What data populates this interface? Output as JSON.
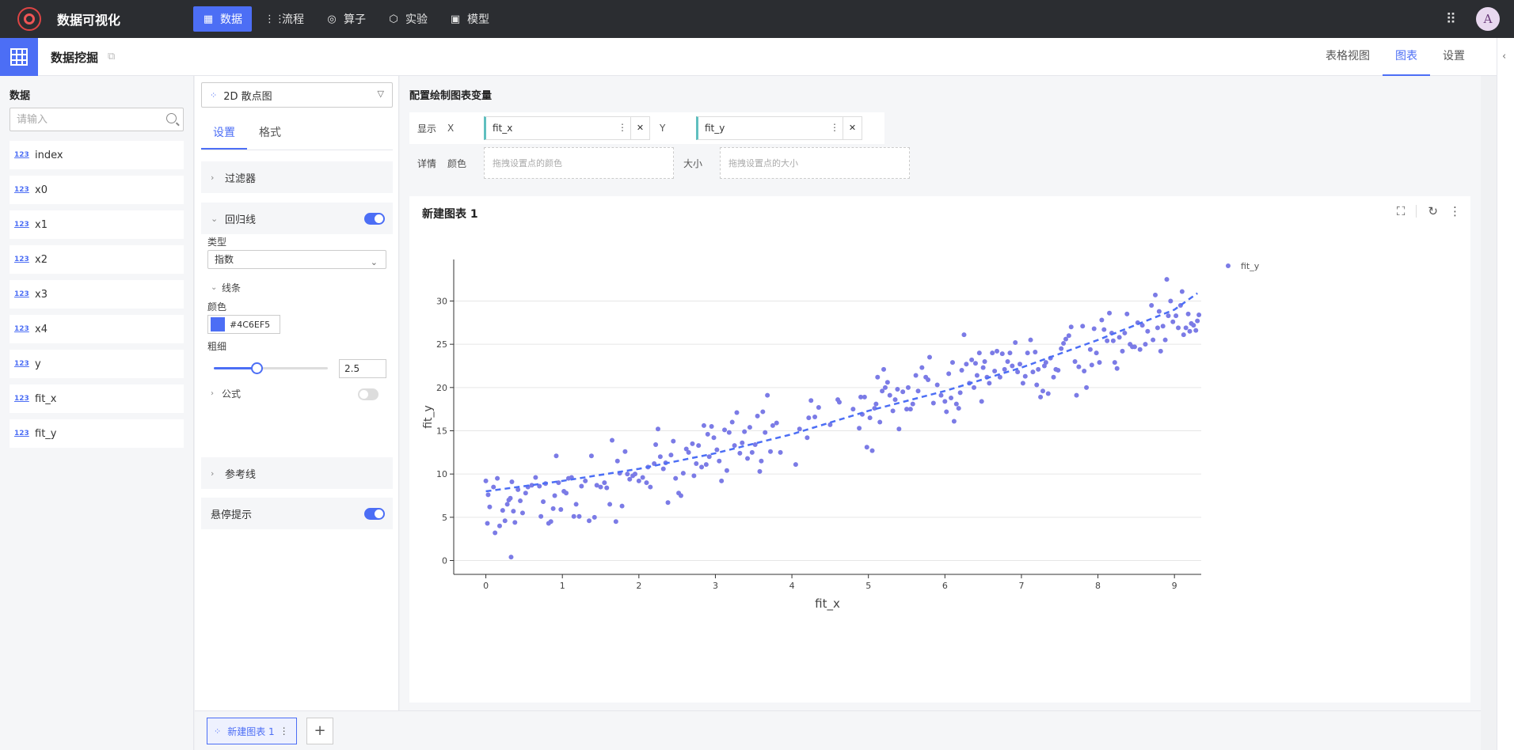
{
  "app": {
    "title": "数据可视化",
    "avatar": "A"
  },
  "nav": [
    {
      "label": "数据",
      "icon": "table-icon",
      "glyph": "▦",
      "active": true
    },
    {
      "label": "流程",
      "icon": "flow-icon",
      "glyph": "⋮⋮"
    },
    {
      "label": "算子",
      "icon": "operator-icon",
      "glyph": "◎"
    },
    {
      "label": "实验",
      "icon": "cube-icon",
      "glyph": "⬡"
    },
    {
      "label": "模型",
      "icon": "save-icon",
      "glyph": "▣"
    }
  ],
  "page": {
    "title": "数据挖掘"
  },
  "view_tabs": [
    {
      "label": "表格视图"
    },
    {
      "label": "图表",
      "active": true
    },
    {
      "label": "设置"
    }
  ],
  "data_panel": {
    "title": "数据",
    "search_placeholder": "请输入",
    "type_badge": "123",
    "fields": [
      "index",
      "x0",
      "x1",
      "x2",
      "x3",
      "x4",
      "y",
      "fit_x",
      "fit_y"
    ]
  },
  "config": {
    "chart_type": "2D 散点图",
    "tabs": [
      "设置",
      "格式"
    ],
    "filter_label": "过滤器",
    "regression_label": "回归线",
    "type_label": "类型",
    "type_value": "指数",
    "line_label": "线条",
    "color_label": "颜色",
    "color_value": "#4C6EF5",
    "width_label": "粗细",
    "width_value": "2.5",
    "width_fraction": 0.375,
    "formula_label": "公式",
    "refline_label": "参考线",
    "tooltip_label": "悬停提示"
  },
  "main": {
    "config_title": "配置绘制图表变量",
    "show_label": "显示",
    "detail_label": "详情",
    "x_label": "X",
    "y_label": "Y",
    "x_var": "fit_x",
    "y_var": "fit_y",
    "color_label": "颜色",
    "color_placeholder": "拖拽设置点的颜色",
    "size_label": "大小",
    "size_placeholder": "拖拽设置点的大小",
    "chart_title": "新建图表 1"
  },
  "bottom": {
    "tab_label": "新建图表 1",
    "add_label": "+"
  },
  "colors": {
    "accent": "#4c6ef5",
    "point": "#7b7be6",
    "nav_bg": "#2b2d31"
  },
  "chart_data": {
    "type": "scatter",
    "xlabel": "fit_x",
    "ylabel": "fit_y",
    "xlim": [
      -0.42,
      9.35
    ],
    "ylim": [
      -1.6,
      34.8
    ],
    "x_ticks": [
      0,
      1,
      2,
      3,
      4,
      5,
      6,
      7,
      8,
      9
    ],
    "y_ticks": [
      0,
      5,
      10,
      15,
      20,
      25,
      30
    ],
    "grid": true,
    "legend": "top-right",
    "series": [
      {
        "name": "fit_y",
        "points": [
          [
            0.0,
            9.2
          ],
          [
            0.02,
            4.3
          ],
          [
            0.03,
            7.6
          ],
          [
            0.05,
            6.2
          ],
          [
            0.1,
            8.5
          ],
          [
            0.12,
            3.2
          ],
          [
            0.15,
            9.5
          ],
          [
            0.18,
            4.0
          ],
          [
            0.22,
            5.8
          ],
          [
            0.25,
            4.6
          ],
          [
            0.28,
            6.5
          ],
          [
            0.3,
            7.0
          ],
          [
            0.32,
            7.2
          ],
          [
            0.34,
            9.1
          ],
          [
            0.36,
            5.7
          ],
          [
            0.38,
            4.4
          ],
          [
            0.33,
            0.4
          ],
          [
            0.42,
            8.2
          ],
          [
            0.45,
            6.9
          ],
          [
            0.48,
            5.5
          ],
          [
            0.52,
            7.8
          ],
          [
            0.55,
            8.5
          ],
          [
            0.6,
            8.7
          ],
          [
            0.65,
            9.6
          ],
          [
            0.7,
            8.6
          ],
          [
            0.72,
            5.1
          ],
          [
            0.75,
            6.8
          ],
          [
            0.78,
            8.9
          ],
          [
            0.82,
            4.3
          ],
          [
            0.85,
            4.5
          ],
          [
            0.88,
            6.0
          ],
          [
            0.9,
            7.5
          ],
          [
            0.92,
            12.1
          ],
          [
            0.95,
            9.0
          ],
          [
            0.98,
            5.9
          ],
          [
            1.02,
            8.0
          ],
          [
            1.05,
            7.8
          ],
          [
            1.08,
            9.5
          ],
          [
            1.12,
            9.6
          ],
          [
            1.15,
            5.1
          ],
          [
            1.18,
            6.5
          ],
          [
            1.22,
            5.1
          ],
          [
            1.25,
            8.6
          ],
          [
            1.3,
            9.2
          ],
          [
            1.35,
            4.6
          ],
          [
            1.38,
            12.1
          ],
          [
            1.42,
            5.0
          ],
          [
            1.45,
            8.7
          ],
          [
            1.5,
            8.5
          ],
          [
            1.55,
            9.0
          ],
          [
            1.58,
            8.4
          ],
          [
            1.62,
            6.5
          ],
          [
            1.65,
            13.9
          ],
          [
            1.7,
            4.5
          ],
          [
            1.72,
            11.5
          ],
          [
            1.75,
            10.1
          ],
          [
            1.78,
            6.3
          ],
          [
            1.82,
            12.6
          ],
          [
            1.85,
            10.0
          ],
          [
            1.88,
            9.4
          ],
          [
            1.92,
            9.8
          ],
          [
            1.95,
            10.0
          ],
          [
            2.0,
            9.2
          ],
          [
            2.05,
            9.6
          ],
          [
            2.1,
            9.0
          ],
          [
            2.12,
            10.8
          ],
          [
            2.15,
            8.5
          ],
          [
            2.2,
            11.2
          ],
          [
            2.22,
            13.4
          ],
          [
            2.25,
            15.2
          ],
          [
            2.28,
            12.0
          ],
          [
            2.32,
            10.6
          ],
          [
            2.35,
            11.3
          ],
          [
            2.38,
            6.7
          ],
          [
            2.42,
            12.2
          ],
          [
            2.45,
            13.8
          ],
          [
            2.48,
            9.5
          ],
          [
            2.52,
            7.8
          ],
          [
            2.55,
            7.5
          ],
          [
            2.58,
            10.1
          ],
          [
            2.62,
            12.9
          ],
          [
            2.65,
            12.5
          ],
          [
            2.7,
            13.5
          ],
          [
            2.72,
            9.8
          ],
          [
            2.75,
            11.2
          ],
          [
            2.78,
            13.3
          ],
          [
            2.82,
            10.8
          ],
          [
            2.85,
            15.6
          ],
          [
            2.88,
            11.1
          ],
          [
            2.9,
            14.6
          ],
          [
            2.92,
            12.0
          ],
          [
            2.95,
            15.5
          ],
          [
            2.98,
            14.2
          ],
          [
            3.02,
            12.8
          ],
          [
            3.05,
            11.5
          ],
          [
            3.08,
            9.2
          ],
          [
            3.12,
            15.1
          ],
          [
            3.15,
            10.4
          ],
          [
            3.18,
            14.8
          ],
          [
            3.22,
            16.0
          ],
          [
            3.25,
            13.3
          ],
          [
            3.28,
            17.1
          ],
          [
            3.32,
            12.4
          ],
          [
            3.35,
            13.6
          ],
          [
            3.38,
            14.9
          ],
          [
            3.42,
            11.8
          ],
          [
            3.45,
            15.4
          ],
          [
            3.48,
            12.5
          ],
          [
            3.52,
            13.4
          ],
          [
            3.55,
            16.7
          ],
          [
            3.58,
            10.3
          ],
          [
            3.6,
            11.5
          ],
          [
            3.62,
            17.2
          ],
          [
            3.65,
            14.8
          ],
          [
            3.68,
            19.1
          ],
          [
            3.72,
            12.6
          ],
          [
            3.75,
            15.6
          ],
          [
            3.8,
            15.9
          ],
          [
            3.85,
            12.5
          ],
          [
            4.05,
            11.1
          ],
          [
            4.1,
            15.2
          ],
          [
            4.2,
            14.2
          ],
          [
            4.22,
            16.5
          ],
          [
            4.25,
            18.5
          ],
          [
            4.3,
            16.6
          ],
          [
            4.35,
            17.7
          ],
          [
            4.5,
            15.7
          ],
          [
            4.6,
            18.6
          ],
          [
            4.62,
            18.3
          ],
          [
            4.8,
            17.5
          ],
          [
            4.88,
            15.3
          ],
          [
            4.9,
            18.9
          ],
          [
            4.92,
            16.9
          ],
          [
            4.95,
            18.9
          ],
          [
            4.98,
            13.1
          ],
          [
            5.02,
            16.5
          ],
          [
            5.05,
            12.7
          ],
          [
            5.08,
            17.6
          ],
          [
            5.1,
            18.1
          ],
          [
            5.12,
            21.2
          ],
          [
            5.15,
            16.0
          ],
          [
            5.18,
            19.6
          ],
          [
            5.2,
            22.1
          ],
          [
            5.22,
            20.0
          ],
          [
            5.25,
            20.6
          ],
          [
            5.28,
            19.1
          ],
          [
            5.32,
            17.3
          ],
          [
            5.35,
            18.6
          ],
          [
            5.38,
            19.8
          ],
          [
            5.4,
            15.2
          ],
          [
            5.45,
            19.5
          ],
          [
            5.5,
            17.5
          ],
          [
            5.52,
            20.0
          ],
          [
            5.55,
            17.5
          ],
          [
            5.58,
            18.1
          ],
          [
            5.62,
            21.4
          ],
          [
            5.65,
            19.6
          ],
          [
            5.7,
            22.3
          ],
          [
            5.75,
            21.2
          ],
          [
            5.78,
            20.9
          ],
          [
            5.8,
            23.5
          ],
          [
            5.85,
            18.2
          ],
          [
            5.9,
            20.3
          ],
          [
            5.95,
            19.1
          ],
          [
            6.0,
            18.4
          ],
          [
            6.02,
            17.2
          ],
          [
            6.05,
            21.6
          ],
          [
            6.08,
            18.8
          ],
          [
            6.1,
            22.9
          ],
          [
            6.12,
            16.1
          ],
          [
            6.15,
            18.1
          ],
          [
            6.18,
            17.6
          ],
          [
            6.2,
            19.4
          ],
          [
            6.22,
            22.0
          ],
          [
            6.25,
            26.1
          ],
          [
            6.28,
            22.7
          ],
          [
            6.32,
            20.5
          ],
          [
            6.35,
            23.2
          ],
          [
            6.38,
            20.0
          ],
          [
            6.4,
            22.8
          ],
          [
            6.42,
            21.4
          ],
          [
            6.45,
            24.0
          ],
          [
            6.48,
            18.4
          ],
          [
            6.5,
            22.3
          ],
          [
            6.52,
            23.0
          ],
          [
            6.55,
            21.2
          ],
          [
            6.58,
            20.5
          ],
          [
            6.62,
            24.0
          ],
          [
            6.65,
            21.9
          ],
          [
            6.68,
            24.2
          ],
          [
            6.72,
            21.2
          ],
          [
            6.75,
            23.9
          ],
          [
            6.78,
            22.1
          ],
          [
            6.82,
            23.0
          ],
          [
            6.85,
            24.0
          ],
          [
            6.88,
            22.5
          ],
          [
            6.92,
            25.2
          ],
          [
            6.95,
            21.8
          ],
          [
            6.98,
            22.7
          ],
          [
            7.02,
            20.5
          ],
          [
            7.05,
            21.3
          ],
          [
            7.08,
            24.0
          ],
          [
            7.12,
            25.5
          ],
          [
            7.15,
            21.8
          ],
          [
            7.18,
            24.1
          ],
          [
            7.2,
            20.3
          ],
          [
            7.22,
            22.1
          ],
          [
            7.25,
            18.9
          ],
          [
            7.28,
            19.6
          ],
          [
            7.3,
            22.5
          ],
          [
            7.32,
            22.9
          ],
          [
            7.35,
            19.3
          ],
          [
            7.38,
            23.4
          ],
          [
            7.42,
            21.2
          ],
          [
            7.45,
            22.1
          ],
          [
            7.48,
            22.0
          ],
          [
            7.52,
            24.5
          ],
          [
            7.55,
            25.1
          ],
          [
            7.58,
            25.6
          ],
          [
            7.62,
            26.0
          ],
          [
            7.65,
            27.0
          ],
          [
            7.7,
            23.0
          ],
          [
            7.72,
            19.1
          ],
          [
            7.75,
            22.4
          ],
          [
            7.8,
            27.1
          ],
          [
            7.82,
            21.9
          ],
          [
            7.85,
            20.0
          ],
          [
            7.9,
            24.4
          ],
          [
            7.92,
            22.6
          ],
          [
            7.95,
            26.8
          ],
          [
            7.98,
            24.0
          ],
          [
            8.02,
            22.9
          ],
          [
            8.05,
            27.8
          ],
          [
            8.08,
            26.7
          ],
          [
            8.12,
            25.4
          ],
          [
            8.15,
            28.6
          ],
          [
            8.18,
            26.3
          ],
          [
            8.2,
            25.4
          ],
          [
            8.22,
            22.9
          ],
          [
            8.25,
            22.2
          ],
          [
            8.28,
            25.8
          ],
          [
            8.32,
            24.2
          ],
          [
            8.35,
            26.3
          ],
          [
            8.38,
            28.5
          ],
          [
            8.42,
            25.0
          ],
          [
            8.45,
            24.7
          ],
          [
            8.48,
            24.7
          ],
          [
            8.52,
            27.5
          ],
          [
            8.55,
            24.4
          ],
          [
            8.58,
            27.2
          ],
          [
            8.62,
            25.0
          ],
          [
            8.65,
            26.5
          ],
          [
            8.7,
            29.5
          ],
          [
            8.72,
            25.5
          ],
          [
            8.75,
            30.7
          ],
          [
            8.78,
            26.9
          ],
          [
            8.8,
            28.8
          ],
          [
            8.82,
            24.2
          ],
          [
            8.85,
            27.1
          ],
          [
            8.88,
            25.5
          ],
          [
            8.9,
            32.5
          ],
          [
            8.92,
            28.3
          ],
          [
            8.95,
            30.0
          ],
          [
            8.98,
            27.6
          ],
          [
            9.02,
            28.3
          ],
          [
            9.05,
            26.9
          ],
          [
            9.08,
            29.5
          ],
          [
            9.1,
            31.1
          ],
          [
            9.12,
            26.1
          ],
          [
            9.15,
            26.9
          ],
          [
            9.18,
            28.5
          ],
          [
            9.2,
            26.5
          ],
          [
            9.22,
            27.4
          ],
          [
            9.25,
            27.2
          ],
          [
            9.28,
            26.6
          ],
          [
            9.3,
            27.7
          ],
          [
            9.32,
            28.4
          ]
        ]
      }
    ],
    "regression": {
      "kind": "exponential",
      "points": [
        [
          0.0,
          8.0
        ],
        [
          1.0,
          9.2
        ],
        [
          2.0,
          10.6
        ],
        [
          3.0,
          12.4
        ],
        [
          4.0,
          14.6
        ],
        [
          5.0,
          17.3
        ],
        [
          6.0,
          19.6
        ],
        [
          7.0,
          22.3
        ],
        [
          8.0,
          25.5
        ],
        [
          9.0,
          29.0
        ],
        [
          9.3,
          30.9
        ]
      ]
    }
  }
}
